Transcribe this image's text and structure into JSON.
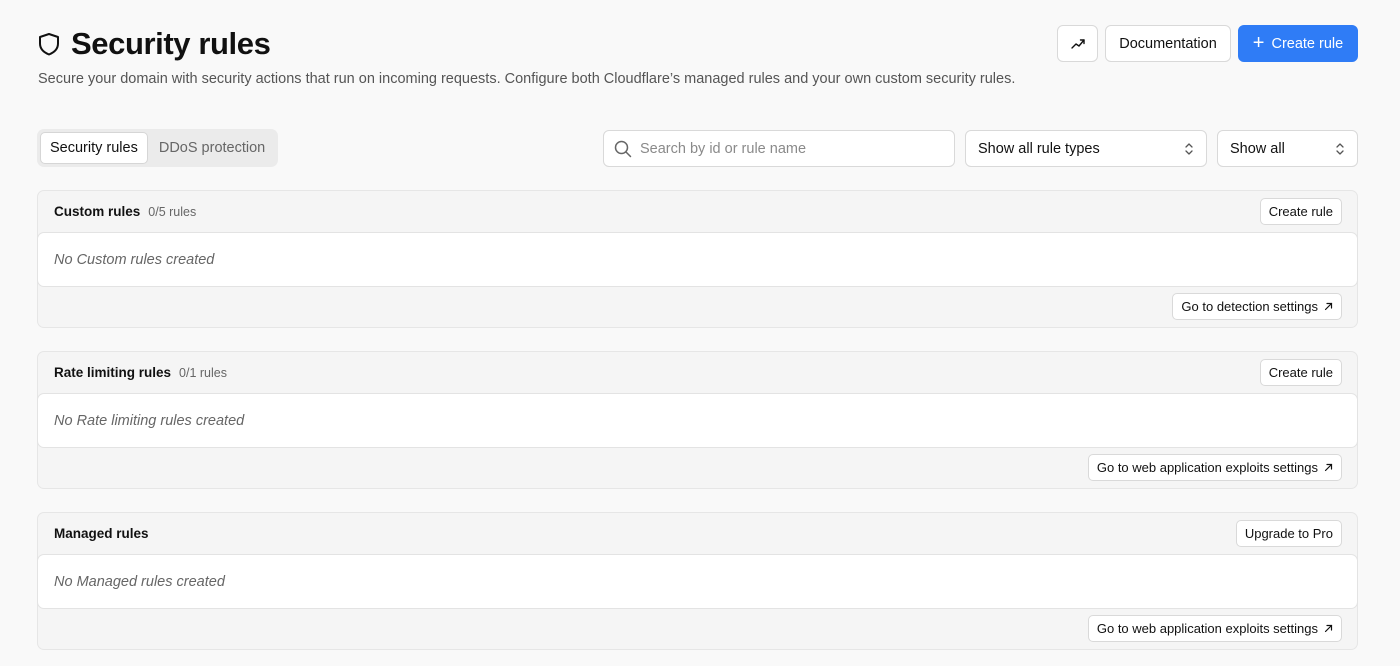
{
  "header": {
    "title": "Security rules",
    "subtitle": "Secure your domain with security actions that run on incoming requests. Configure both Cloudflare’s managed rules and your own custom security rules.",
    "documentation_label": "Documentation",
    "create_rule_label": "Create rule",
    "accent_color": "#2f7cf6"
  },
  "tabs": [
    {
      "label": "Security rules",
      "active": true
    },
    {
      "label": "DDoS protection",
      "active": false
    }
  ],
  "search": {
    "placeholder": "Search by id or rule name",
    "value": ""
  },
  "filters": {
    "rule_types": "Show all rule types",
    "show": "Show all"
  },
  "sections": [
    {
      "title": "Custom rules",
      "count": "0/5 rules",
      "action_label": "Create rule",
      "empty_text": "No Custom rules created",
      "footer_link": "Go to detection settings"
    },
    {
      "title": "Rate limiting rules",
      "count": "0/1 rules",
      "action_label": "Create rule",
      "empty_text": "No Rate limiting rules created",
      "footer_link": "Go to web application exploits settings"
    },
    {
      "title": "Managed rules",
      "count": "",
      "action_label": "Upgrade to Pro",
      "empty_text": "No Managed rules created",
      "footer_link": "Go to web application exploits settings"
    }
  ]
}
